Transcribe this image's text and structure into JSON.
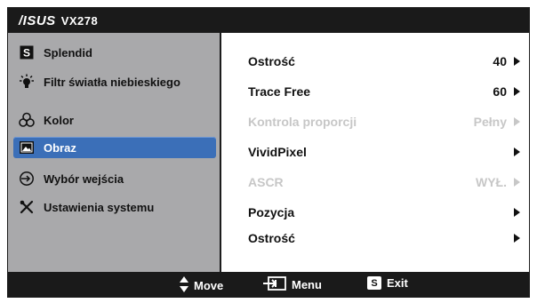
{
  "header": {
    "brand": "/ISUS",
    "model": "VX278"
  },
  "sidebar": {
    "items": [
      {
        "label": "Splendid",
        "icon": "splendid-s-icon"
      },
      {
        "label": "Filtr światła niebieskiego",
        "icon": "bulb-icon"
      },
      {
        "label": "Kolor",
        "icon": "color-circles-icon"
      },
      {
        "label": "Obraz",
        "icon": "image-icon",
        "selected": true
      },
      {
        "label": "Wybór wejścia",
        "icon": "input-arrow-icon"
      },
      {
        "label": "Ustawienia systemu",
        "icon": "tools-icon"
      }
    ]
  },
  "main": {
    "items": [
      {
        "label": "Ostrość",
        "value": "40",
        "enabled": true
      },
      {
        "label": "Trace Free",
        "value": "60",
        "enabled": true
      },
      {
        "label": "Kontrola proporcji",
        "value": "Pełny",
        "enabled": false
      },
      {
        "label": "VividPixel",
        "value": "",
        "enabled": true
      },
      {
        "label": "ASCR",
        "value": "WYŁ.",
        "enabled": false
      },
      {
        "label": "Pozycja",
        "value": "",
        "enabled": true
      },
      {
        "label": "Ostrość",
        "value": "",
        "enabled": true
      }
    ]
  },
  "footer": {
    "move_label": "Move",
    "menu_label": "Menu",
    "exit_label": "Exit",
    "exit_key": "S"
  },
  "colors": {
    "bar": "#1a1a1a",
    "sidebar_bg": "#a9a9ab",
    "selected": "#3b6fb8",
    "disabled_text": "#c7c7c7"
  }
}
